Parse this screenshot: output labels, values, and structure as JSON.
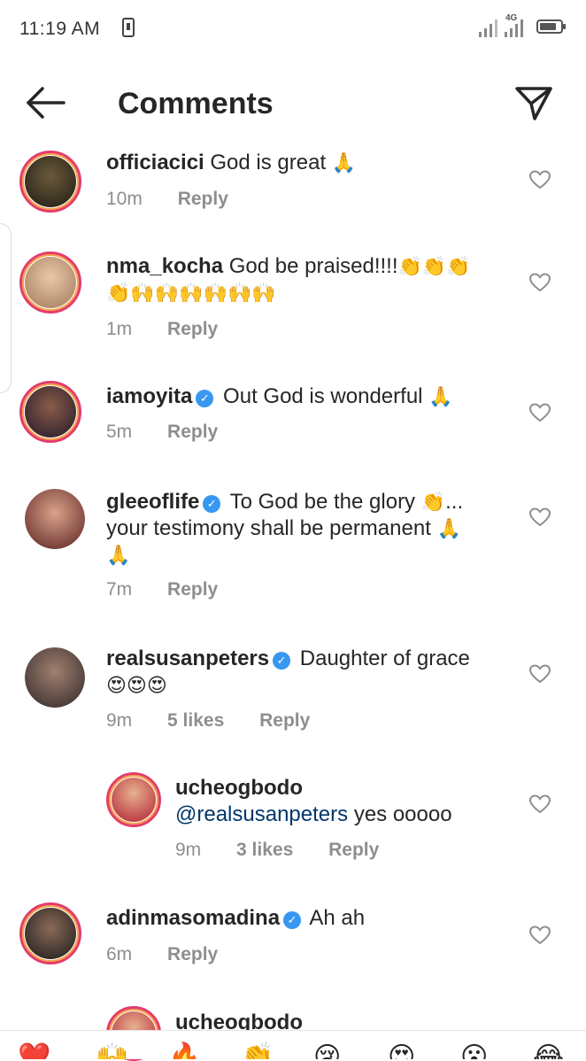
{
  "status_bar": {
    "time": "11:19 AM",
    "network": "4G"
  },
  "header": {
    "title": "Comments",
    "back_icon": "back-arrow-icon",
    "send_icon": "paper-plane-icon"
  },
  "comments": [
    {
      "username": "officiacici",
      "verified": false,
      "text": "God is great",
      "emoji": "🙏",
      "time": "10m",
      "likes": "",
      "reply": "Reply",
      "avatar_color": "#2c2a1e"
    },
    {
      "username": "nma_kocha",
      "verified": false,
      "text": "God be praised!!!!",
      "emoji": "👏👏👏",
      "emoji2": "👏🙌🙌🙌🙌🙌🙌",
      "time": "1m",
      "likes": "",
      "reply": "Reply",
      "avatar_color": "#c9a07a"
    },
    {
      "username": "iamoyita",
      "verified": true,
      "text": "Out God is wonderful",
      "emoji": "🙏",
      "time": "5m",
      "likes": "",
      "reply": "Reply",
      "avatar_color": "#3a2b3c"
    },
    {
      "username": "gleeoflife",
      "verified": true,
      "text": "To God be the glory",
      "emoji": "👏",
      "text2": "...",
      "line2": "your testimony shall be permanent",
      "emoji2": "🙏",
      "emoji3": "🙏",
      "time": "7m",
      "likes": "",
      "reply": "Reply",
      "avatar_color": "#8a3a3a"
    },
    {
      "username": "realsusanpeters",
      "verified": true,
      "text": "Daughter of grace",
      "emoji": "😍😍😍",
      "time": "9m",
      "likes": "5 likes",
      "reply": "Reply",
      "avatar_color": "#555050"
    },
    {
      "username": "ucheogbodo",
      "verified": false,
      "mention": "@realsusanpeters",
      "text": "yes ooooo",
      "time": "9m",
      "likes": "3 likes",
      "reply": "Reply",
      "avatar_color": "#c0323a"
    },
    {
      "username": "adinmasomadina",
      "verified": true,
      "text": "Ah ah",
      "time": "6m",
      "likes": "",
      "reply": "Reply",
      "avatar_color": "#2a2a2a"
    },
    {
      "username": "ucheogbodo",
      "avatar_color": "#c0323a"
    }
  ],
  "quick_emojis": [
    "❤️",
    "🙌",
    "🔥",
    "👏",
    "😢",
    "😍",
    "😮",
    "😂"
  ]
}
